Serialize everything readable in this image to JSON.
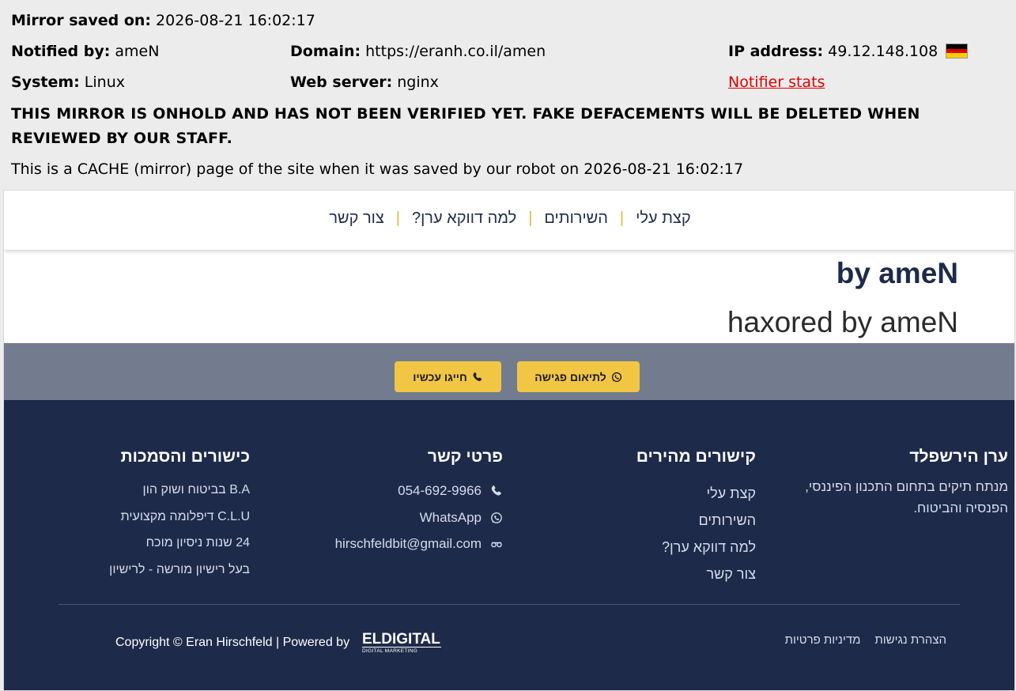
{
  "mirror": {
    "saved_label": "Mirror saved on:",
    "saved_value": "2026-08-21 16:02:17",
    "notified_label": "Notified by:",
    "notified_value": "ameN",
    "domain_label": "Domain:",
    "domain_value": "https://eranh.co.il/amen",
    "ip_label": "IP address:",
    "ip_value": "49.12.148.108",
    "flag_icon": "germany-flag-icon",
    "system_label": "System:",
    "system_value": "Linux",
    "webserver_label": "Web server:",
    "webserver_value": "nginx",
    "notifier_stats": "Notifier stats",
    "warning_line1": "THIS MIRROR IS ONHOLD AND HAS NOT BEEN VERIFIED YET. FAKE DEFACEMENTS WILL BE DELETED WHEN",
    "warning_line2": "REVIEWED BY OUR STAFF.",
    "cache_note": "This is a CACHE (mirror) page of the site when it was saved by our robot on 2026-08-21 16:02:17"
  },
  "site": {
    "nav": [
      "קצת עלי",
      "השירותים",
      "למה דווקא ערן?",
      "צור קשר"
    ],
    "heading": "by ameN",
    "subheading": "haxored by ameN",
    "cta": {
      "meeting": "לתיאום פגישה",
      "call": "חייגו עכשיו"
    },
    "footer": {
      "about_title": "ערן הירשפלד",
      "about_line1": "מנתח תיקים בתחום התכנון הפיננסי,",
      "about_line2": "הפנסיה והביטוח.",
      "links_title": "קישורים מהירים",
      "links": [
        "קצת עלי",
        "השירותים",
        "למה דווקא ערן?",
        "צור קשר"
      ],
      "contact_title": "פרטי קשר",
      "phone": "054-692-9966",
      "whatsapp": "WhatsApp",
      "email": "hirschfeldbit@gmail.com",
      "quals_title": "כישורים והסמכות",
      "quals": [
        "B.A בביטוח ושוק הון",
        "C.L.U דיפלומה מקצועית",
        "24 שנות ניסיון מוכח",
        "בעל רישיון מורשה - לרישיון"
      ],
      "copyright": "Copyright © Eran Hirschfeld | Powered by",
      "logo_main": "ELDIGITAL",
      "logo_sub": "DIGITAL MARKETING",
      "accessibility": "הצהרת נגישות",
      "privacy": "מדיניות פרטיות"
    }
  },
  "colors": {
    "accent": "#f1c644",
    "footer_bg": "#1e2a4a",
    "cta_bg": "#727c8e",
    "link_red": "#e00000"
  }
}
